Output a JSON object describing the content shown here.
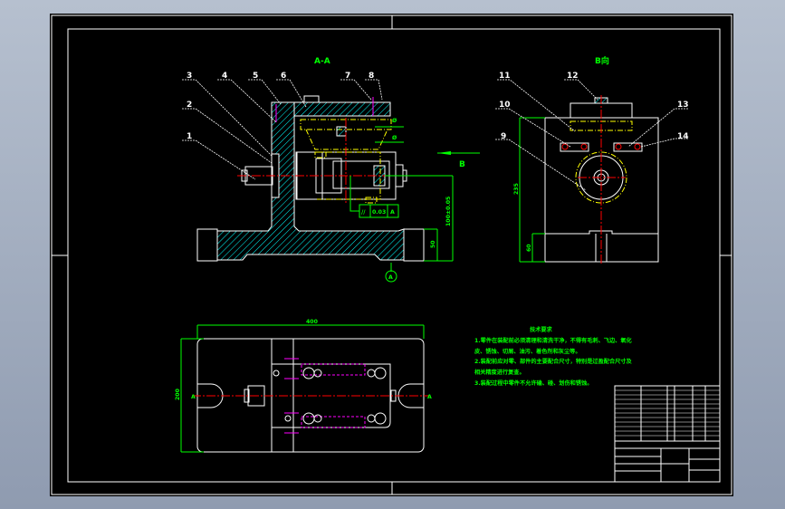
{
  "colors": {
    "sheet": "#000000",
    "outline": "#ffffff",
    "dimension": "#00ff00",
    "hidden": "#ffff00",
    "center": "#ff0000",
    "section_hatch": "#00ffff",
    "fastener": "#ff00ff"
  },
  "views": {
    "section_title": "A-A",
    "direction_title": "B向",
    "direction_arrow_label": "B",
    "datum_label": "A"
  },
  "part_numbers": {
    "front": [
      "1",
      "2",
      "3",
      "4",
      "5",
      "6",
      "7",
      "8"
    ],
    "side": [
      "9",
      "10",
      "11",
      "12",
      "13",
      "14"
    ]
  },
  "dimensions": {
    "front_height": "100±0.05",
    "front_base": "50",
    "side_height": "235",
    "side_base": "60",
    "plan_length": "400",
    "plan_width": "200",
    "tolerance_symbol": "//",
    "tolerance_value": "0.03",
    "tolerance_datum": "A",
    "section_mark": "A"
  },
  "tech_requirements": {
    "heading": "技术要求",
    "lines": [
      "1.零件在装配前必须清理和清洗干净，不得有毛刺、飞边、氧化",
      "皮、锈蚀、切屑、油污、着色剂和灰尘等。",
      "2.装配前应对零、部件的主要配合尺寸，特别是过盈配合尺寸及",
      "相关精度进行复查。",
      "3.装配过程中零件不允许磕、碰、划伤和锈蚀。"
    ]
  }
}
